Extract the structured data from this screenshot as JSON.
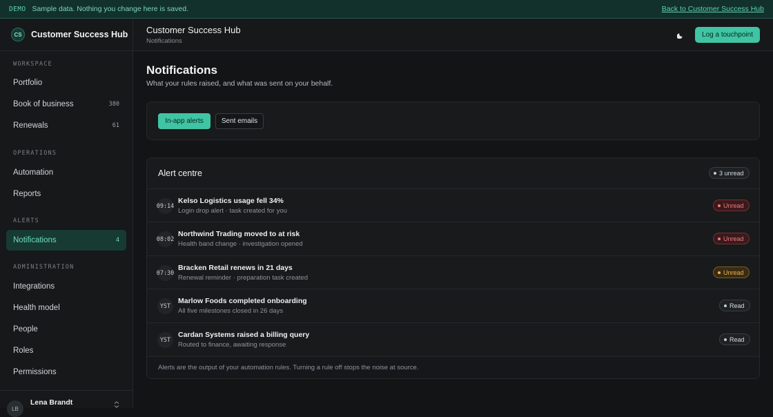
{
  "banner": {
    "tag": "DEMO",
    "message": "Sample data. Nothing you change here is saved.",
    "back_link": "Back to Customer Success Hub"
  },
  "brand": {
    "initials": "CS",
    "name": "Customer Success Hub"
  },
  "sidebar": {
    "sections": [
      {
        "label": "WORKSPACE"
      },
      {
        "label": "OPERATIONS"
      },
      {
        "label": "ALERTS"
      },
      {
        "label": "ADMINISTRATION"
      }
    ],
    "items": [
      {
        "label": "Portfolio",
        "count": ""
      },
      {
        "label": "Book of business",
        "count": "380"
      },
      {
        "label": "Renewals",
        "count": "61"
      },
      {
        "label": "Automation",
        "count": ""
      },
      {
        "label": "Reports",
        "count": ""
      },
      {
        "label": "Notifications",
        "count": "4"
      },
      {
        "label": "Integrations",
        "count": ""
      },
      {
        "label": "Health model",
        "count": ""
      },
      {
        "label": "People",
        "count": ""
      },
      {
        "label": "Roles",
        "count": ""
      },
      {
        "label": "Permissions",
        "count": ""
      }
    ],
    "active_item": "Notifications",
    "user": {
      "initials": "LB",
      "name": "Lena Brandt"
    }
  },
  "header": {
    "title": "Customer Success Hub",
    "breadcrumb": "Notifications",
    "theme_icon": "moon-icon",
    "log_button": "Log a touchpoint"
  },
  "page": {
    "title": "Notifications",
    "subtitle": "What your rules raised, and what was sent on your behalf."
  },
  "tabs": {
    "active": "In-app alerts",
    "inactive": "Sent emails"
  },
  "alerts": {
    "title": "Alert centre",
    "unread_badge": "3 unread",
    "rows": [
      {
        "time": "09:14",
        "title": "Kelso Logistics usage fell 34%",
        "subtitle": "Login drop alert · task created for you",
        "status": "Unread",
        "tone": "red"
      },
      {
        "time": "08:02",
        "title": "Northwind Trading moved to at risk",
        "subtitle": "Health band change · investigation opened",
        "status": "Unread",
        "tone": "red"
      },
      {
        "time": "07:30",
        "title": "Bracken Retail renews in 21 days",
        "subtitle": "Renewal reminder · preparation task created",
        "status": "Unread",
        "tone": "amber"
      },
      {
        "time": "YST",
        "title": "Marlow Foods completed onboarding",
        "subtitle": "All five milestones closed in 26 days",
        "status": "Read",
        "tone": "neutral"
      },
      {
        "time": "YST",
        "title": "Cardan Systems raised a billing query",
        "subtitle": "Routed to finance, awaiting response",
        "status": "Read",
        "tone": "neutral"
      }
    ],
    "footer": "Alerts are the output of your automation rules. Turning a rule off stops the noise at source."
  },
  "colors": {
    "accent": "#3fc5a3",
    "unread_red": "#ef7a7e",
    "unread_amber": "#e8b556"
  }
}
